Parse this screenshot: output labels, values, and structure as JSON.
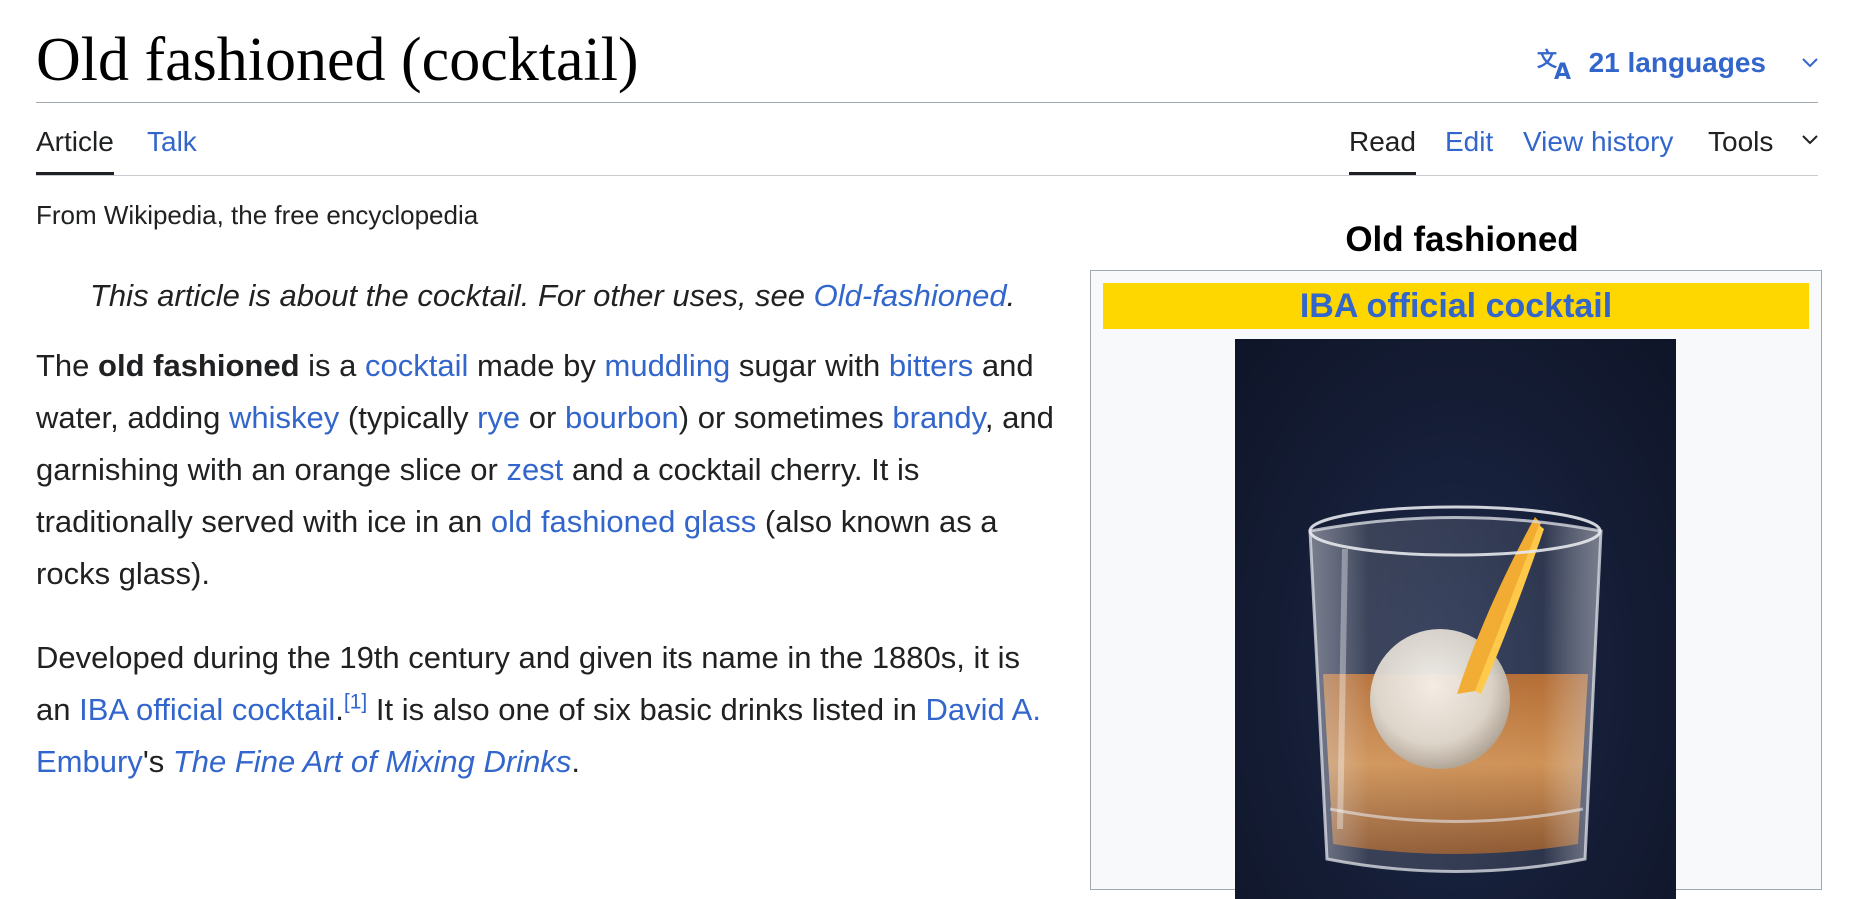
{
  "page": {
    "title": "Old fashioned (cocktail)",
    "languages_label": "21 languages"
  },
  "tabs": {
    "left": [
      "Article",
      "Talk"
    ],
    "right": [
      "Read",
      "Edit",
      "View history",
      "Tools"
    ]
  },
  "tagline": "From Wikipedia, the free encyclopedia",
  "hatnote": {
    "text": "This article is about the cocktail. For other uses, see ",
    "link": "Old-fashioned",
    "end": "."
  },
  "paragraph1": {
    "t1": "The ",
    "b1": "old fashioned",
    "t2": " is a ",
    "l1": "cocktail",
    "t3": " made by ",
    "l2": "muddling",
    "t4": " sugar with ",
    "l3": "bitters",
    "t5": " and water, adding ",
    "l4": "whiskey",
    "t6": " (typically ",
    "l5": "rye",
    "t7": " or ",
    "l6": "bourbon",
    "t8": ") or sometimes ",
    "l7": "brandy",
    "t9": ", and garnishing with an orange slice or ",
    "l8": "zest",
    "t10": " and a cocktail cherry. It is traditionally served with ice in an ",
    "l9": "old fashioned glass",
    "t11": " (also known as a rocks glass)."
  },
  "paragraph2": {
    "t1": "Developed during the 19th century and given its name in the 1880s, it is an ",
    "l1": "IBA official cocktail",
    "t2": ".",
    "ref": "[1]",
    "t3": " It is also one of six basic drinks listed in ",
    "l2": "David A. Embury",
    "t4": "'s ",
    "l3": "The Fine Art of Mixing Drinks",
    "t5": "."
  },
  "infobox": {
    "caption": "Old fashioned",
    "header": "IBA official cocktail"
  },
  "colors": {
    "link": "#3366cc",
    "infobox_header_bg": "#ffd700",
    "infobox_bg": "#f8f9fa",
    "photo_bg": "#141c34"
  },
  "icons": [
    "translate-icon",
    "chevron-down-icon"
  ]
}
